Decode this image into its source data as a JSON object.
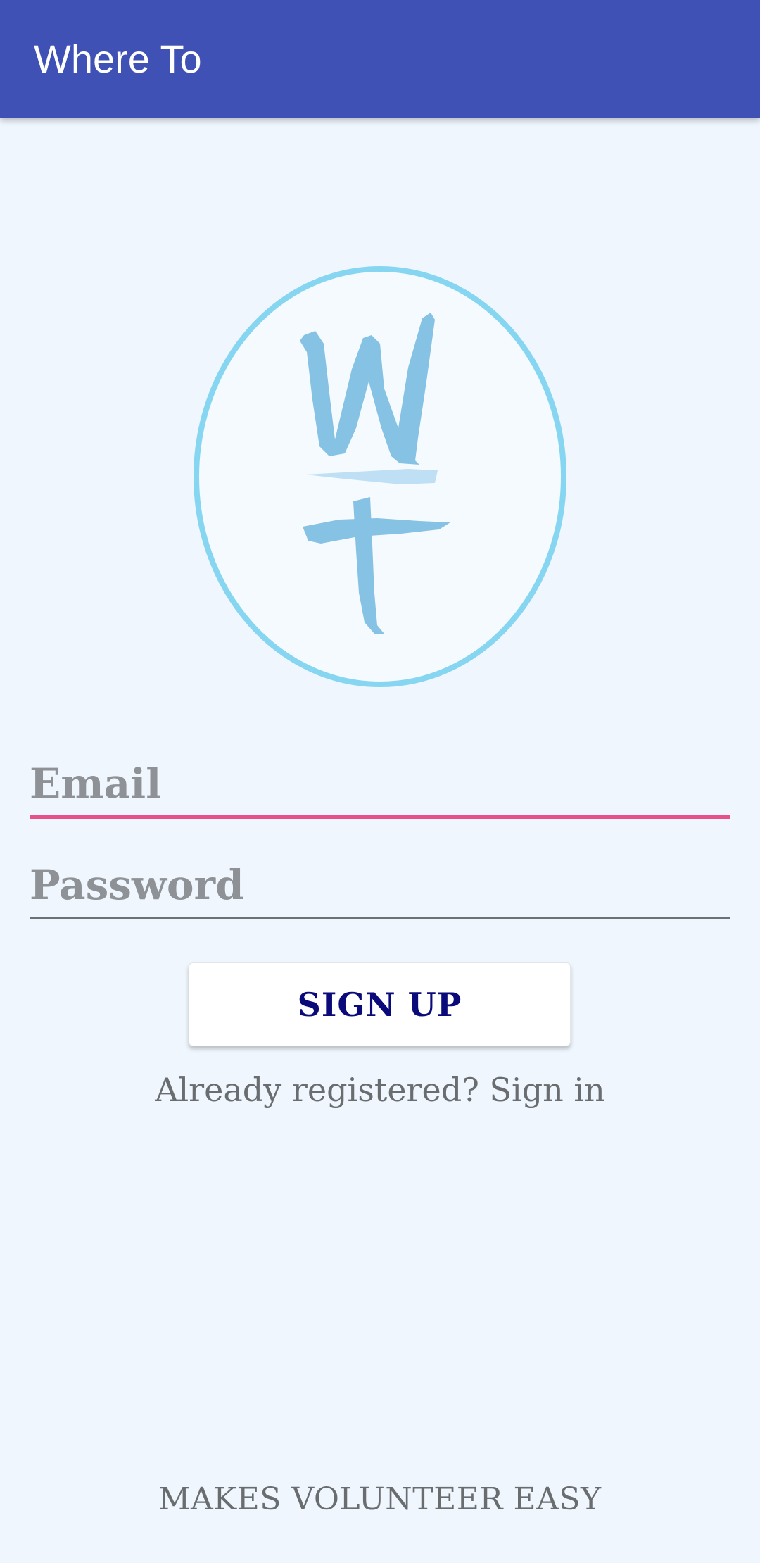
{
  "app_bar": {
    "title": "Where To",
    "color": "#3F51B5"
  },
  "logo": {
    "icon": "wt-logo-icon",
    "ring_color": "#86D6F2",
    "letter_color": "#86C2E4"
  },
  "form": {
    "email": {
      "placeholder": "Email",
      "value": "",
      "accent_color": "#E8508A"
    },
    "password": {
      "placeholder": "Password",
      "value": ""
    },
    "signup_label": "SIGN UP",
    "signin_link": "Already registered? Sign in"
  },
  "footer": {
    "tagline": "MAKES VOLUNTEER EASY"
  }
}
